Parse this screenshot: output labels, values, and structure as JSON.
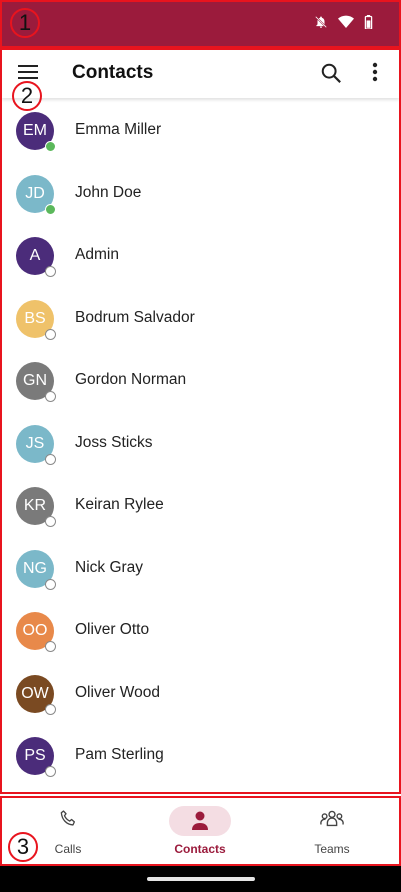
{
  "annotations": {
    "region1": "1",
    "region2": "2",
    "region3": "3"
  },
  "status_bar": {
    "icons": [
      "bell-off-icon",
      "wifi-icon",
      "battery-icon"
    ],
    "color": "#9b1b3c"
  },
  "app_bar": {
    "title": "Contacts",
    "icons": [
      "menu-icon",
      "search-icon",
      "more-vert-icon"
    ]
  },
  "contacts": [
    {
      "initials": "EM",
      "name": "Emma Miller",
      "color": "#4b2c7a",
      "status": "online"
    },
    {
      "initials": "JD",
      "name": "John Doe",
      "color": "#7bb8c9",
      "status": "online"
    },
    {
      "initials": "A",
      "name": "Admin",
      "color": "#4b2c7a",
      "status": "offline"
    },
    {
      "initials": "BS",
      "name": "Bodrum Salvador",
      "color": "#efc26a",
      "status": "offline"
    },
    {
      "initials": "GN",
      "name": "Gordon Norman",
      "color": "#7a7a7a",
      "status": "offline"
    },
    {
      "initials": "JS",
      "name": "Joss Sticks",
      "color": "#7bb8c9",
      "status": "offline"
    },
    {
      "initials": "KR",
      "name": "Keiran Rylee",
      "color": "#7a7a7a",
      "status": "offline"
    },
    {
      "initials": "NG",
      "name": "Nick Gray",
      "color": "#7bb8c9",
      "status": "offline"
    },
    {
      "initials": "OO",
      "name": "Oliver Otto",
      "color": "#e8894a",
      "status": "offline"
    },
    {
      "initials": "OW",
      "name": "Oliver Wood",
      "color": "#7a4a22",
      "status": "offline"
    },
    {
      "initials": "PS",
      "name": "Pam Sterling",
      "color": "#4b2c7a",
      "status": "offline"
    }
  ],
  "bottom_nav": {
    "calls": "Calls",
    "contacts": "Contacts",
    "teams": "Teams",
    "active_color": "#9b1b3c"
  }
}
